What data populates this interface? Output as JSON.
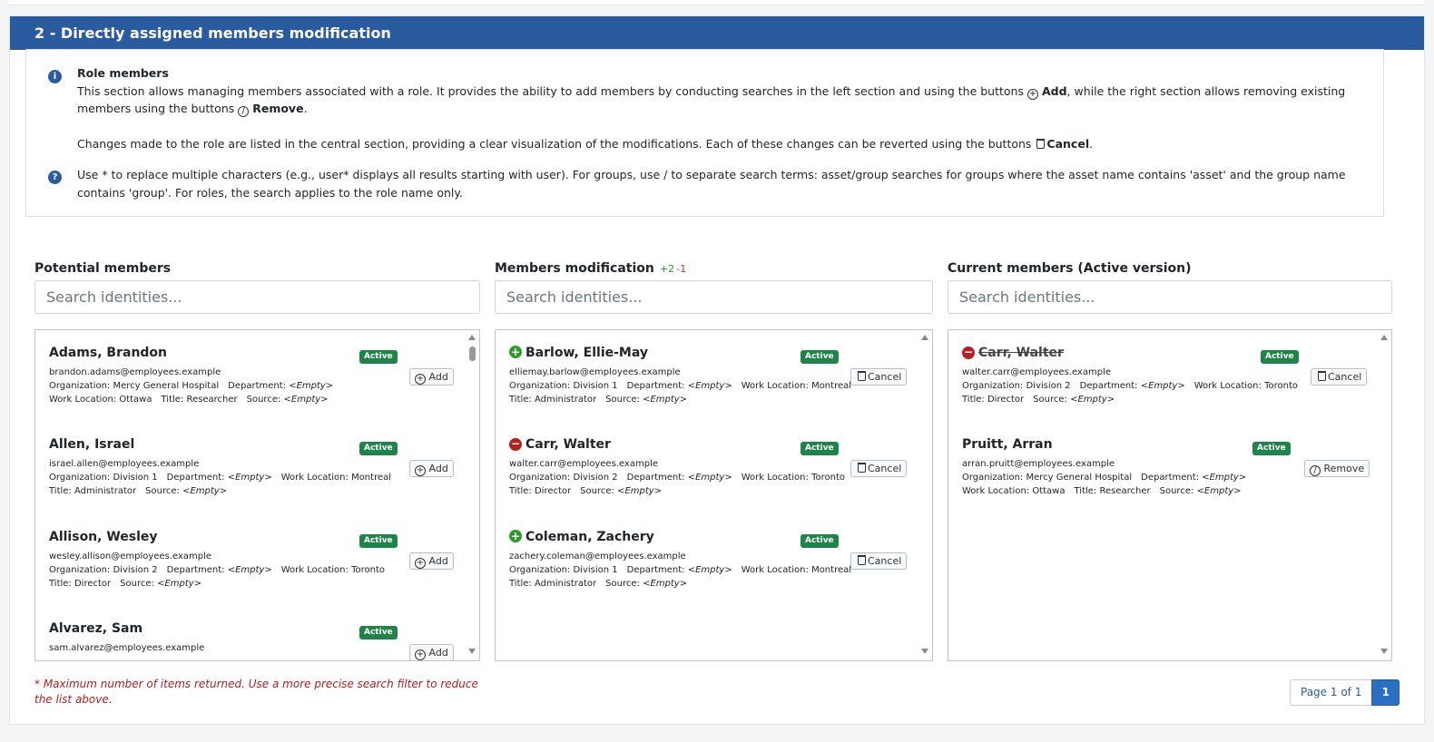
{
  "header": {
    "title": "2 - Directly assigned members modification"
  },
  "info": {
    "title": "Role members",
    "p1a": "This section allows managing members associated with a role. It provides the ability to add members by conducting searches in the left section and using the buttons ",
    "add_label": "Add",
    "p1b": ", while the right section allows removing existing members using the buttons ",
    "remove_label": "Remove",
    "p1c": ".",
    "p2a": "Changes made to the role are listed in the central section, providing a clear visualization of the modifications. Each of these changes can be reverted using the buttons ",
    "cancel_label": "Cancel",
    "p2b": ".",
    "help": "Use * to replace multiple characters (e.g., user* displays all results starting with user). For groups, use / to separate search terms: asset/group searches for groups where the asset name contains 'asset' and the group name contains 'group'. For roles, the search applies to the role name only."
  },
  "columns": {
    "potential": {
      "title": "Potential members",
      "placeholder": "Search identities..."
    },
    "modification": {
      "title": "Members modification",
      "plus": "+2",
      "minus": "-1",
      "placeholder": "Search identities..."
    },
    "current": {
      "title": "Current members (Active version)",
      "placeholder": "Search identities..."
    }
  },
  "potential_items": [
    {
      "name": "Adams, Brandon",
      "email": "brandon.adams@employees.example",
      "l2": [
        "Organization: Mercy General Hospital",
        "Department: ",
        "<Empty>"
      ],
      "l3": [
        "Work Location: Ottawa",
        "Title: Researcher",
        "Source: ",
        "<Empty>"
      ],
      "badge": "Active",
      "button": "Add"
    },
    {
      "name": "Allen, Israel",
      "email": "israel.allen@employees.example",
      "l2": [
        "Organization: Division 1",
        "Department: ",
        "<Empty>",
        "Work Location: Montreal"
      ],
      "l3": [
        "Title: Administrator",
        "Source: ",
        "<Empty>"
      ],
      "badge": "Active",
      "button": "Add"
    },
    {
      "name": "Allison, Wesley",
      "email": "wesley.allison@employees.example",
      "l2": [
        "Organization: Division 2",
        "Department: ",
        "<Empty>",
        "Work Location: Toronto"
      ],
      "l3": [
        "Title: Director",
        "Source: ",
        "<Empty>"
      ],
      "badge": "Active",
      "button": "Add"
    },
    {
      "name": "Alvarez, Sam",
      "email": "sam.alvarez@employees.example",
      "badge": "Active",
      "button": "Add"
    }
  ],
  "modification_items": [
    {
      "name": "Barlow, Ellie-May",
      "change": "add",
      "email": "elliemay.barlow@employees.example",
      "l2": [
        "Organization: Division 1",
        "Department: ",
        "<Empty>",
        "Work Location: Montreal"
      ],
      "l3": [
        "Title: Administrator",
        "Source: ",
        "<Empty>"
      ],
      "badge": "Active",
      "button": "Cancel"
    },
    {
      "name": "Carr, Walter",
      "change": "remove",
      "email": "walter.carr@employees.example",
      "l2": [
        "Organization: Division 2",
        "Department: ",
        "<Empty>",
        "Work Location: Toronto"
      ],
      "l3": [
        "Title: Director",
        "Source: ",
        "<Empty>"
      ],
      "badge": "Active",
      "button": "Cancel"
    },
    {
      "name": "Coleman, Zachery",
      "change": "add",
      "email": "zachery.coleman@employees.example",
      "l2": [
        "Organization: Division 1",
        "Department: ",
        "<Empty>",
        "Work Location: Montreal"
      ],
      "l3": [
        "Title: Administrator",
        "Source: ",
        "<Empty>"
      ],
      "badge": "Active",
      "button": "Cancel"
    }
  ],
  "current_items": [
    {
      "name": "Carr, Walter",
      "struck": true,
      "email": "walter.carr@employees.example",
      "l2": [
        "Organization: Division 2",
        "Department: ",
        "<Empty>",
        "Work Location: Toronto"
      ],
      "l3": [
        "Title: Director",
        "Source: ",
        "<Empty>"
      ],
      "badge": "Active",
      "button": "Cancel"
    },
    {
      "name": "Pruitt, Arran",
      "email": "arran.pruitt@employees.example",
      "l2": [
        "Organization: Mercy General Hospital",
        "Department: ",
        "<Empty>"
      ],
      "l3": [
        "Work Location: Ottawa",
        "Title: Researcher",
        "Source: ",
        "<Empty>"
      ],
      "badge": "Active",
      "button": "Remove"
    }
  ],
  "footnote": "* Maximum number of items returned. Use a more precise search filter to reduce the list above.",
  "pagination": {
    "info": "Page 1 of 1",
    "current": "1"
  },
  "colors": {
    "header": "#2a5b9e",
    "badge": "#1e8449",
    "add": "#2d9a2d",
    "remove": "#b51f1f",
    "footnote": "#b01c1c"
  }
}
